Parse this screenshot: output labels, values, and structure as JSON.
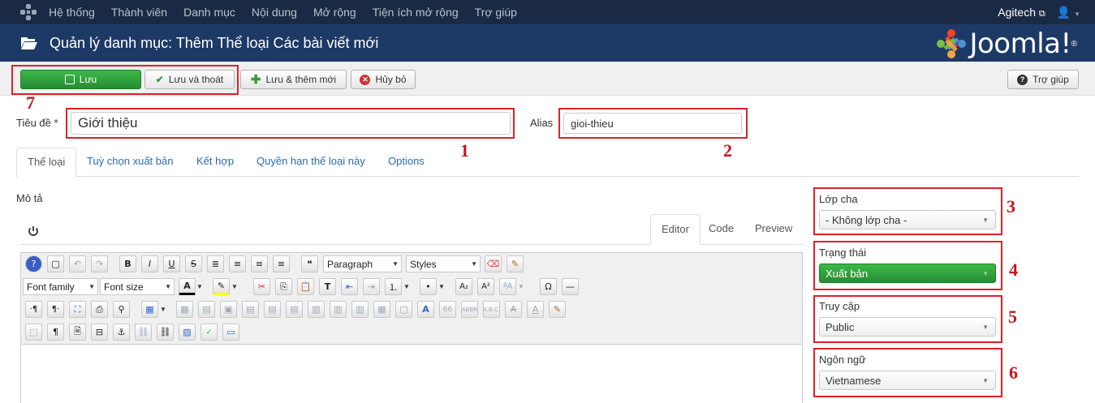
{
  "topnav": {
    "items": [
      {
        "label": "Hệ thống"
      },
      {
        "label": "Thành viên"
      },
      {
        "label": "Danh mục"
      },
      {
        "label": "Nội dung"
      },
      {
        "label": "Mở rộng"
      },
      {
        "label": "Tiện ích mở rộng"
      },
      {
        "label": "Trợ giúp"
      }
    ],
    "user_link": "Agitech"
  },
  "titlebar": {
    "title": "Quản lý danh mục: Thêm Thể loại Các bài viết mới",
    "brand": "Joomla!",
    "brand_mark": "®"
  },
  "toolbar": {
    "save_label": "Lưu",
    "save_close_label": "Lưu và thoát",
    "save_new_label": "Lưu & thêm mới",
    "cancel_label": "Hủy bỏ",
    "help_label": "Trợ giúp"
  },
  "form": {
    "title_label": "Tiêu đề *",
    "title_value": "Giới thiệu",
    "alias_label": "Alias",
    "alias_value": "gioi-thieu"
  },
  "tabs": [
    {
      "label": "Thể loại"
    },
    {
      "label": "Tuỳ chọn xuất bản"
    },
    {
      "label": "Kết hợp"
    },
    {
      "label": "Quyền hạn thể loại này"
    },
    {
      "label": "Options"
    }
  ],
  "editor": {
    "description_label": "Mô tả",
    "tabs": [
      {
        "label": "Editor"
      },
      {
        "label": "Code"
      },
      {
        "label": "Preview"
      }
    ],
    "format_select": "Paragraph",
    "styles_select": "Styles",
    "font_family_select": "Font family",
    "font_size_select": "Font size"
  },
  "sidebar": {
    "parent_label": "Lớp cha",
    "parent_value": "- Không lớp cha -",
    "status_label": "Trạng thái",
    "status_value": "Xuất bản",
    "access_label": "Truy cập",
    "access_value": "Public",
    "language_label": "Ngôn ngữ",
    "language_value": "Vietnamese"
  },
  "annotations": {
    "n1": "1",
    "n2": "2",
    "n3": "3",
    "n4": "4",
    "n5": "5",
    "n6": "6",
    "n7": "7"
  },
  "colors": {
    "topnav_bg": "#1b2a44",
    "titlebar_bg": "#1d3a66",
    "save_green": "#2f9e3a",
    "annotation_red": "#e0202a"
  }
}
